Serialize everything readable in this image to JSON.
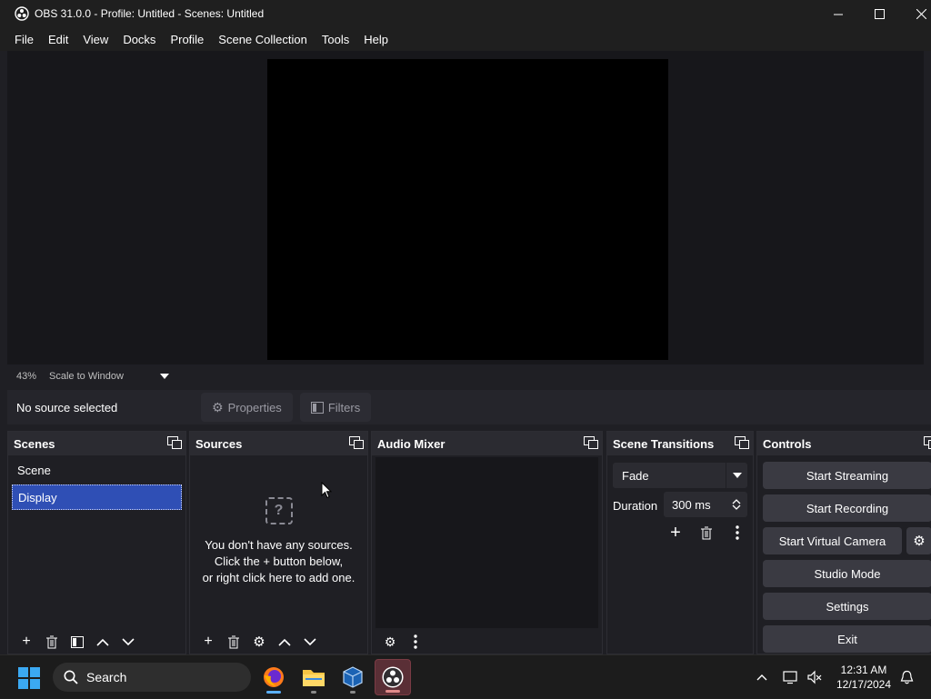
{
  "window": {
    "title": "OBS 31.0.0 - Profile: Untitled - Scenes: Untitled",
    "controls": [
      "minimize",
      "maximize",
      "close"
    ]
  },
  "menu": {
    "items": [
      "File",
      "Edit",
      "View",
      "Docks",
      "Profile",
      "Scene Collection",
      "Tools",
      "Help"
    ]
  },
  "preview": {
    "zoom": "43%",
    "scale_mode": "Scale to Window"
  },
  "source_bar": {
    "status": "No source selected",
    "properties_label": "Properties",
    "filters_label": "Filters"
  },
  "scenes": {
    "title": "Scenes",
    "items": [
      {
        "label": "Scene",
        "selected": false
      },
      {
        "label": "Display",
        "selected": true
      }
    ]
  },
  "sources": {
    "title": "Sources",
    "empty_line1": "You don't have any sources.",
    "empty_line2": "Click the + button below,",
    "empty_line3": "or right click here to add one.",
    "empty_icon": "?"
  },
  "audio_mixer": {
    "title": "Audio Mixer"
  },
  "transitions": {
    "title": "Scene Transitions",
    "selected": "Fade",
    "duration_label": "Duration",
    "duration_value": "300 ms"
  },
  "controls": {
    "title": "Controls",
    "start_streaming": "Start Streaming",
    "start_recording": "Start Recording",
    "start_virtual_camera": "Start Virtual Camera",
    "studio_mode": "Studio Mode",
    "settings": "Settings",
    "exit": "Exit"
  },
  "taskbar": {
    "search_placeholder": "Search",
    "time": "12:31 AM",
    "date": "12/17/2024",
    "apps": [
      "firefox",
      "file-explorer",
      "virtualbox",
      "obs-studio"
    ]
  },
  "colors": {
    "selected_scene": "#2f4fb5",
    "dock_header": "#2b2b31",
    "button": "#3a3a42"
  }
}
